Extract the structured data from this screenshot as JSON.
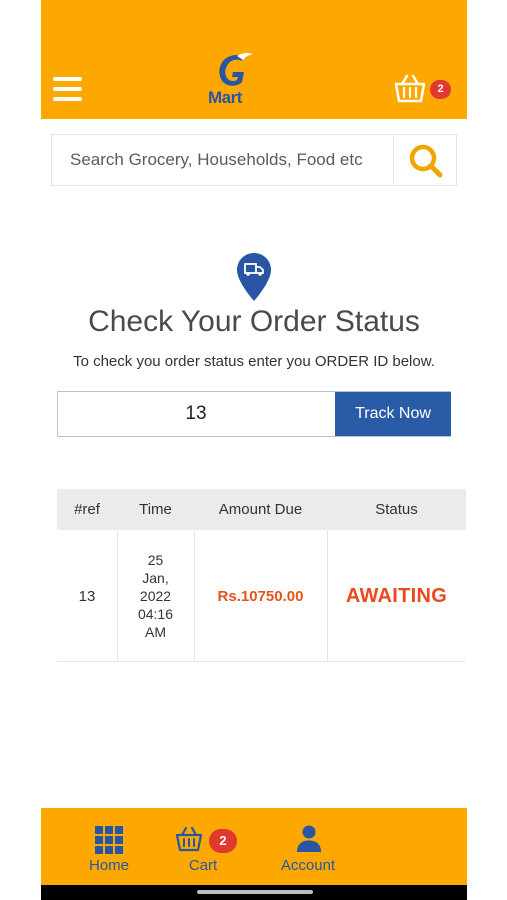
{
  "header": {
    "logo_text": "Mart",
    "cart_badge": "2"
  },
  "search": {
    "placeholder": "Search Grocery, Households, Food etc"
  },
  "order_status": {
    "title": "Check Your Order Status",
    "subtitle": "To check you order status enter you ORDER ID below.",
    "order_id_value": "13",
    "track_button": "Track Now"
  },
  "table": {
    "headers": [
      "#ref",
      "Time",
      "Amount Due",
      "Status"
    ],
    "rows": [
      {
        "ref": "13",
        "time_lines": [
          "25",
          "Jan,",
          "2022",
          "04:16",
          "AM"
        ],
        "amount": "Rs.10750.00",
        "status": "AWAITING"
      }
    ]
  },
  "bottom_nav": {
    "home": "Home",
    "cart": "Cart",
    "cart_badge": "2",
    "account": "Account"
  },
  "colors": {
    "header_bg": "#fca800",
    "brand_blue": "#2856a4",
    "status_orange": "#ea4a1c",
    "badge_red": "#e03a2f"
  }
}
